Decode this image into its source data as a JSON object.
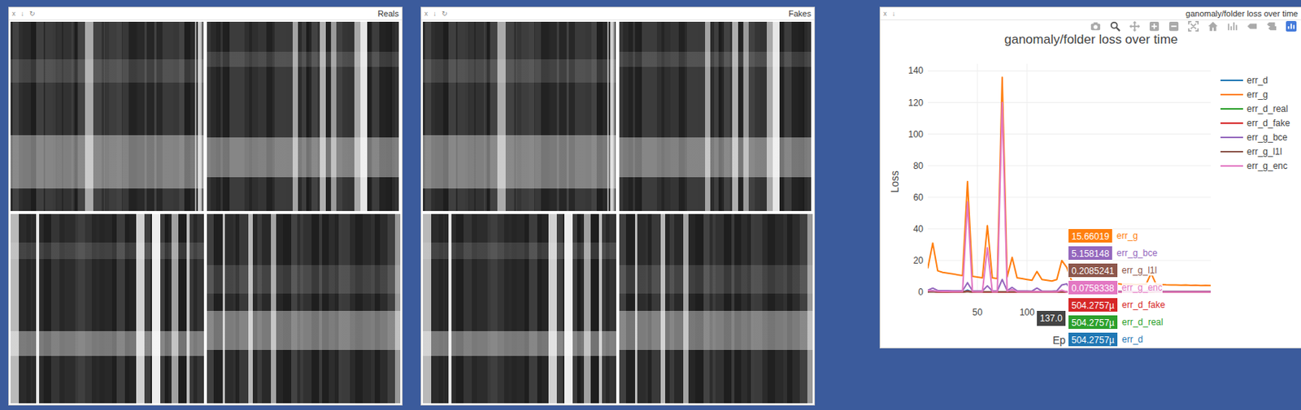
{
  "panes": [
    {
      "title": "Reals",
      "buttons": [
        "x",
        "↓",
        "↻"
      ]
    },
    {
      "title": "Fakes",
      "buttons": [
        "x",
        "↓",
        "↻"
      ]
    }
  ],
  "chart": {
    "pane_title": "ganomaly/folder loss over time",
    "buttons": [
      "x",
      "↓"
    ],
    "title": "ganomaly/folder loss over time",
    "y_axis": {
      "title": "Loss",
      "ticks": [
        "0",
        "20",
        "40",
        "60",
        "80",
        "100",
        "120",
        "140"
      ]
    },
    "x_axis": {
      "title": "Ep",
      "ticks": [
        "50",
        "100"
      ]
    },
    "x": [
      0,
      5,
      10,
      15,
      20,
      25,
      30,
      35,
      40,
      45,
      50,
      55,
      60,
      65,
      70,
      75,
      80,
      85,
      90,
      95,
      100,
      105,
      110,
      115,
      120,
      125,
      130,
      135,
      140,
      145,
      150,
      155,
      160,
      165,
      170,
      175,
      180,
      185,
      190,
      195,
      200,
      205,
      210,
      215,
      220,
      225,
      230,
      235,
      240,
      245,
      250,
      255,
      260,
      265,
      270,
      275,
      280,
      285
    ],
    "series": [
      {
        "name": "err_d",
        "color": "#1f77b4",
        "values": [
          0.4,
          0.9,
          0.05,
          0.02,
          0.01,
          0.01,
          0.01,
          0.01,
          1.2,
          0.01,
          0.001,
          0.001,
          0.001,
          0.001,
          0.001,
          0.001,
          0.001,
          0.001,
          0.001,
          0.001,
          0.001,
          0.001,
          0.001,
          0.001,
          0.001,
          0.001,
          0.001,
          0.001,
          0.001,
          0.001,
          0.001,
          0.001,
          0.001,
          0.001,
          0.001,
          0.001,
          0.001,
          0.001,
          0.001,
          0.001,
          0.001,
          0.001,
          0.001,
          0.001,
          0.001,
          0.001,
          0.001,
          0.001,
          0.001,
          0.001,
          0.001,
          0.001,
          0.001,
          0.001,
          0.001,
          0.001,
          0.001,
          0.001
        ]
      },
      {
        "name": "err_g",
        "color": "#ff7f0e",
        "values": [
          15,
          31,
          13.5,
          12.5,
          12,
          11.5,
          11,
          10.5,
          70,
          10,
          9.5,
          9,
          42,
          9,
          8.5,
          136,
          9.5,
          22,
          9,
          8.5,
          8,
          7.5,
          13,
          8,
          7.5,
          7,
          8,
          20,
          15.66,
          7,
          6.5,
          6,
          6,
          5.5,
          5.5,
          5.5,
          5,
          5,
          5.5,
          5,
          5,
          5,
          4.8,
          5,
          5,
          12,
          5,
          4.8,
          4.6,
          4.5,
          4.5,
          4.4,
          4.5,
          4.3,
          4.4,
          4.2,
          4.3,
          4.2
        ]
      },
      {
        "name": "err_d_real",
        "color": "#2ca02c",
        "values": [
          0.2,
          0.45,
          0.03,
          0.01,
          0.005,
          0.005,
          0.005,
          0.005,
          0.6,
          0.005,
          0.0005,
          0.0005,
          0.0005,
          0.0005,
          0.0005,
          0.0005,
          0.0005,
          0.0005,
          0.0005,
          0.0005,
          0.0005,
          0.0005,
          0.0005,
          0.0005,
          0.0005,
          0.0005,
          0.0005,
          0.0005,
          0.0005,
          0.0005,
          0.0005,
          0.0005,
          0.0005,
          0.0005,
          0.0005,
          0.0005,
          0.0005,
          0.0005,
          0.0005,
          0.0005,
          0.0005,
          0.0005,
          0.0005,
          0.0005,
          0.0005,
          0.0005,
          0.0005,
          0.0005,
          0.0005,
          0.0005,
          0.0005,
          0.0005,
          0.0005,
          0.0005,
          0.0005,
          0.0005,
          0.0005,
          0.0005
        ]
      },
      {
        "name": "err_d_fake",
        "color": "#d62728",
        "values": [
          0.2,
          0.45,
          0.03,
          0.01,
          0.005,
          0.005,
          0.005,
          0.005,
          0.6,
          0.005,
          0.0005,
          0.0005,
          0.0005,
          0.0005,
          0.0005,
          0.0005,
          0.0005,
          0.0005,
          0.0005,
          0.0005,
          0.0005,
          0.0005,
          0.0005,
          0.0005,
          0.0005,
          0.0005,
          0.0005,
          0.0005,
          0.0005,
          0.0005,
          0.0005,
          0.0005,
          0.0005,
          0.0005,
          0.0005,
          0.0005,
          0.0005,
          0.0005,
          0.0005,
          0.0005,
          0.0005,
          0.0005,
          0.0005,
          0.0005,
          0.0005,
          0.0005,
          0.0005,
          0.0005,
          0.0005,
          0.0005,
          0.0005,
          0.0005,
          0.0005,
          0.0005,
          0.0005,
          0.0005,
          0.0005,
          0.0005
        ]
      },
      {
        "name": "err_g_bce",
        "color": "#9467bd",
        "values": [
          1.2,
          2.5,
          1.0,
          0.9,
          0.9,
          0.8,
          0.8,
          0.8,
          6,
          0.8,
          0.7,
          0.7,
          4,
          0.7,
          0.7,
          8,
          0.9,
          3,
          0.8,
          0.7,
          0.7,
          0.6,
          2.5,
          0.7,
          0.6,
          0.6,
          0.8,
          4.5,
          5.16,
          0.7,
          0.6,
          0.6,
          0.5,
          0.5,
          0.5,
          0.5,
          0.5,
          0.5,
          0.6,
          0.5,
          0.5,
          0.5,
          0.5,
          0.5,
          0.5,
          2,
          0.5,
          0.5,
          0.5,
          0.5,
          0.5,
          0.5,
          0.5,
          0.5,
          0.5,
          0.5,
          0.5,
          0.5
        ]
      },
      {
        "name": "err_g_l1l",
        "color": "#8c564b",
        "values": [
          0.28,
          0.28,
          0.27,
          0.27,
          0.26,
          0.26,
          0.25,
          0.25,
          0.26,
          0.25,
          0.25,
          0.24,
          0.25,
          0.24,
          0.24,
          0.26,
          0.24,
          0.24,
          0.23,
          0.23,
          0.23,
          0.23,
          0.23,
          0.22,
          0.22,
          0.22,
          0.22,
          0.22,
          0.21,
          0.21,
          0.21,
          0.21,
          0.21,
          0.21,
          0.21,
          0.21,
          0.21,
          0.21,
          0.21,
          0.21,
          0.2,
          0.2,
          0.2,
          0.2,
          0.2,
          0.2,
          0.2,
          0.2,
          0.2,
          0.2,
          0.2,
          0.2,
          0.2,
          0.2,
          0.2,
          0.2,
          0.2,
          0.2
        ]
      },
      {
        "name": "err_g_enc",
        "color": "#e377c2",
        "values": [
          0.9,
          0.8,
          0.6,
          0.5,
          0.5,
          0.4,
          0.4,
          0.4,
          57,
          0.4,
          0.3,
          0.3,
          28,
          0.3,
          0.3,
          120,
          0.5,
          1.5,
          0.3,
          0.3,
          0.2,
          0.2,
          0.4,
          0.2,
          0.2,
          0.2,
          0.2,
          1.2,
          0.08,
          0.1,
          0.1,
          0.1,
          0.1,
          0.1,
          0.1,
          0.1,
          0.1,
          0.1,
          0.1,
          0.1,
          0.1,
          0.1,
          0.1,
          0.1,
          0.1,
          0.6,
          0.1,
          0.1,
          0.1,
          0.1,
          0.1,
          0.1,
          0.1,
          0.1,
          0.1,
          0.1,
          0.1,
          0.1
        ]
      }
    ],
    "hover": {
      "x_label": "137.0",
      "rows": [
        {
          "name": "err_g",
          "value": "15.66019",
          "color": "#ff7f0e"
        },
        {
          "name": "err_g_bce",
          "value": "5.158148",
          "color": "#9467bd"
        },
        {
          "name": "err_g_l1l",
          "value": "0.2085241",
          "color": "#8c564b"
        },
        {
          "name": "err_g_enc",
          "value": "0.0758338",
          "color": "#e377c2"
        },
        {
          "name": "err_d_fake",
          "value": "504.2757µ",
          "color": "#d62728"
        },
        {
          "name": "err_d_real",
          "value": "504.2757µ",
          "color": "#2ca02c"
        },
        {
          "name": "err_d",
          "value": "504.2757µ",
          "color": "#1f77b4"
        }
      ]
    }
  }
}
